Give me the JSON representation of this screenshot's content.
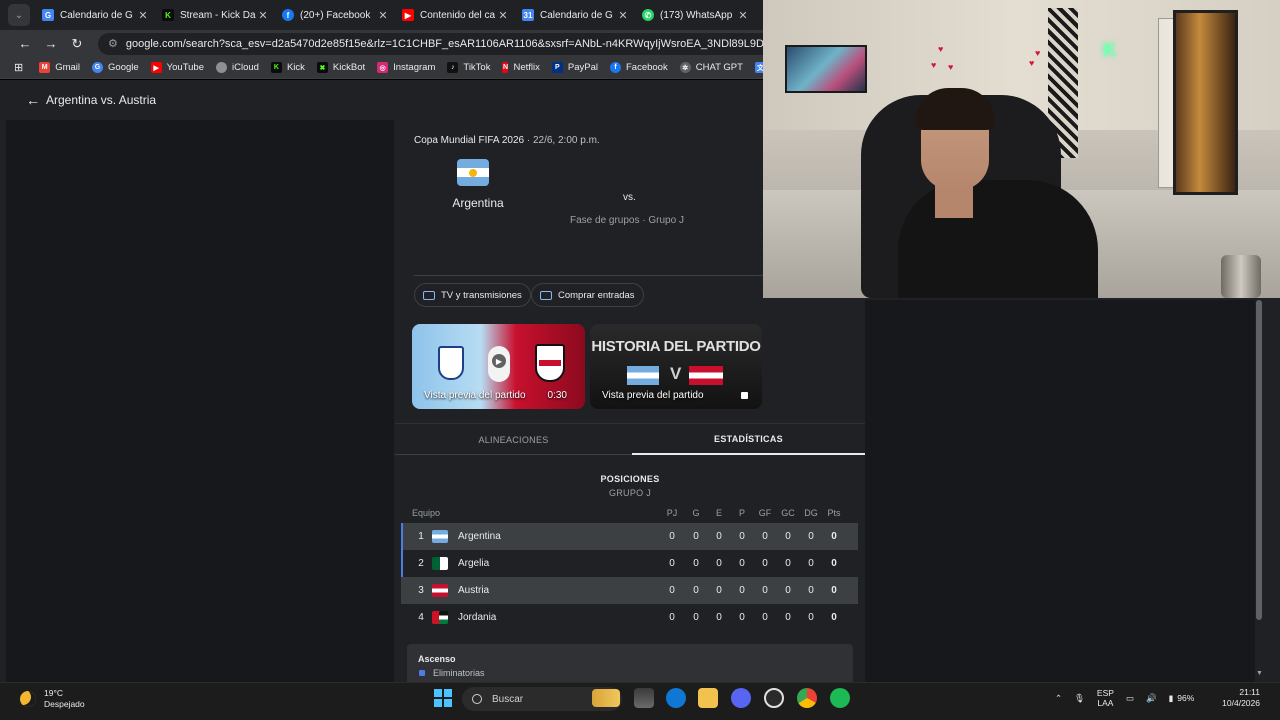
{
  "browser": {
    "tabs": [
      {
        "label": "Calendario de G",
        "favicon": "google-icon",
        "color": "#4285f4"
      },
      {
        "label": "Stream - Kick Da",
        "favicon": "kick-icon",
        "color": "#53fc18"
      },
      {
        "label": "(20+) Facebook",
        "favicon": "facebook-icon",
        "color": "#1877f2"
      },
      {
        "label": "Contenido del ca",
        "favicon": "youtube-studio-icon",
        "color": "#ff0000"
      },
      {
        "label": "Calendario de G",
        "favicon": "google-calendar-icon",
        "color": "#4285f4"
      },
      {
        "label": "(173) WhatsApp",
        "favicon": "whatsapp-icon",
        "color": "#25d366"
      }
    ],
    "url": "google.com/search?sca_esv=d2a5470d2e85f15e&rlz=1C1CHBF_esAR1106AR1106&sxsrf=ANbL-n4KRWqyIjWsroEA_3NDl89L9DS6Fw:17758",
    "bookmarks": [
      {
        "label": "Gmail",
        "icon": "gmail-icon",
        "color": "#ea4335"
      },
      {
        "label": "Google",
        "icon": "google-icon",
        "color": "#4285f4"
      },
      {
        "label": "YouTube",
        "icon": "youtube-icon",
        "color": "#ff0000"
      },
      {
        "label": "iCloud",
        "icon": "icloud-icon",
        "color": "#8e8e93"
      },
      {
        "label": "Kick",
        "icon": "kick-icon",
        "color": "#53fc18"
      },
      {
        "label": "KickBot",
        "icon": "kickbot-icon",
        "color": "#53fc18"
      },
      {
        "label": "Instagram",
        "icon": "instagram-icon",
        "color": "#d62976"
      },
      {
        "label": "TikTok",
        "icon": "tiktok-icon",
        "color": "#111111"
      },
      {
        "label": "Netflix",
        "icon": "netflix-icon",
        "color": "#e50914"
      },
      {
        "label": "PayPal",
        "icon": "paypal-icon",
        "color": "#003087"
      },
      {
        "label": "Facebook",
        "icon": "facebook-icon",
        "color": "#1877f2"
      },
      {
        "label": "CHAT GPT",
        "icon": "chatgpt-icon",
        "color": "#5f6368"
      },
      {
        "label": "G",
        "icon": "google-translate-icon",
        "color": "#4285f4"
      }
    ]
  },
  "page": {
    "title": "Argentina vs. Austria",
    "competition": "Copa Mundial FIFA 2026",
    "datetime": "· 22/6, 2:00 p.m.",
    "home_team": "Argentina",
    "vs": "vs.",
    "stage": "Fase de grupos · Grupo J",
    "chips": {
      "tv": "TV y transmisiones",
      "tickets": "Comprar entradas"
    },
    "videos": [
      {
        "label": "Vista previa del partido",
        "duration": "0:30"
      },
      {
        "label": "Vista previa del partido",
        "overlay_title": "HISTORIA DEL PARTIDO",
        "overlay_v": "V"
      }
    ],
    "tabs": {
      "lineups": "ALINEACIONES",
      "stats": "ESTADÍSTICAS"
    },
    "standings": {
      "title": "POSICIONES",
      "subtitle": "GRUPO J",
      "columns": [
        "Equipo",
        "PJ",
        "G",
        "E",
        "P",
        "GF",
        "GC",
        "DG",
        "Pts"
      ],
      "rows": [
        {
          "rank": "1",
          "team": "Argentina",
          "values": [
            "0",
            "0",
            "0",
            "0",
            "0",
            "0",
            "0",
            "0"
          ]
        },
        {
          "rank": "2",
          "team": "Argelia",
          "values": [
            "0",
            "0",
            "0",
            "0",
            "0",
            "0",
            "0",
            "0"
          ]
        },
        {
          "rank": "3",
          "team": "Austria",
          "values": [
            "0",
            "0",
            "0",
            "0",
            "0",
            "0",
            "0",
            "0"
          ]
        },
        {
          "rank": "4",
          "team": "Jordania",
          "values": [
            "0",
            "0",
            "0",
            "0",
            "0",
            "0",
            "0",
            "0"
          ]
        }
      ],
      "legend_title": "Ascenso",
      "legend_item": "Eliminatorias",
      "legend_color": "#4d7ce4"
    }
  },
  "taskbar": {
    "temperature": "19°C",
    "weather": "Despejado",
    "search_placeholder": "Buscar",
    "lang_top": "ESP",
    "lang_bottom": "LAA",
    "battery": "96%",
    "time": "21:11",
    "date": "10/4/2026"
  }
}
